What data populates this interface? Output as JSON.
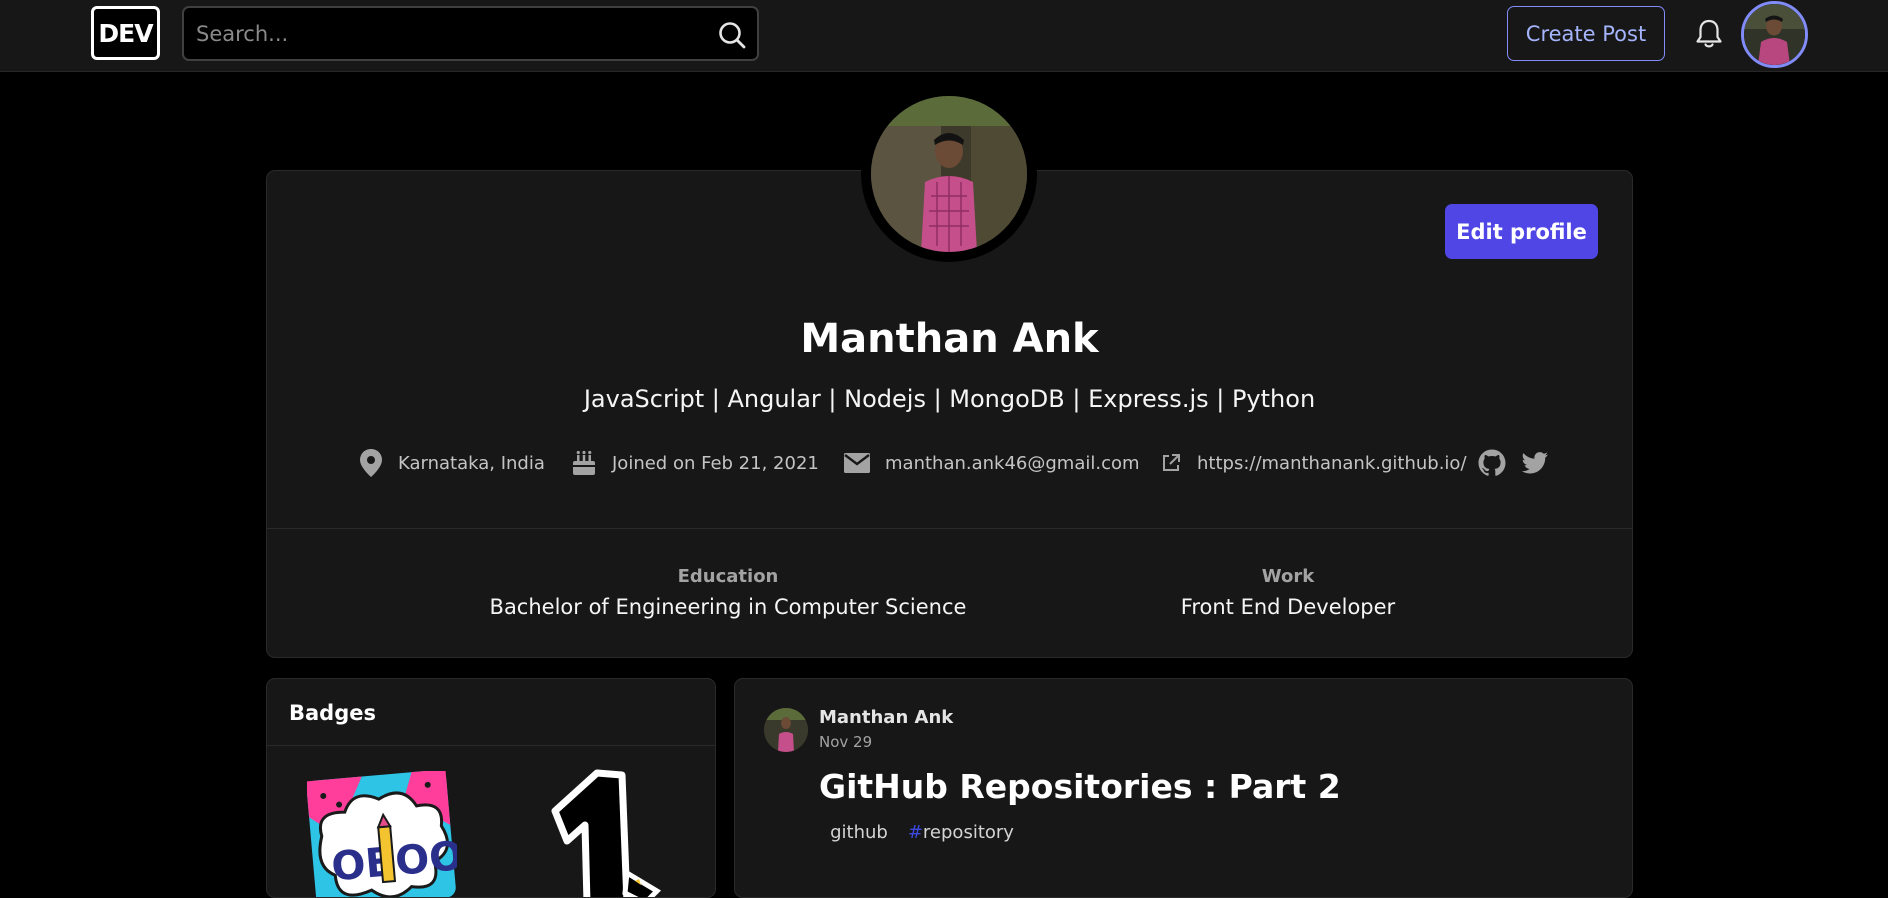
{
  "header": {
    "logo_text": "DEV",
    "search_placeholder": "Search...",
    "create_post_label": "Create Post"
  },
  "profile": {
    "edit_label": "Edit profile",
    "name": "Manthan Ank",
    "bio": "JavaScript | Angular | Nodejs | MongoDB | Express.js | Python",
    "location": "Karnataka, India",
    "joined": "Joined on Feb 21, 2021",
    "email": "manthan.ank46@gmail.com",
    "website": "https://manthanank.github.io/",
    "education_label": "Education",
    "education_value": "Bachelor of Engineering in Computer Science",
    "work_label": "Work",
    "work_value": "Front End Developer"
  },
  "badges": {
    "title": "Badges"
  },
  "post": {
    "author": "Manthan Ank",
    "date": "Nov 29",
    "title": "GitHub Repositories : Part 2",
    "tags": [
      "github",
      "repository"
    ]
  },
  "colors": {
    "accent": "#4f46e5",
    "accent_light": "#818cf8",
    "card_bg": "#171717",
    "page_bg": "#000000"
  }
}
